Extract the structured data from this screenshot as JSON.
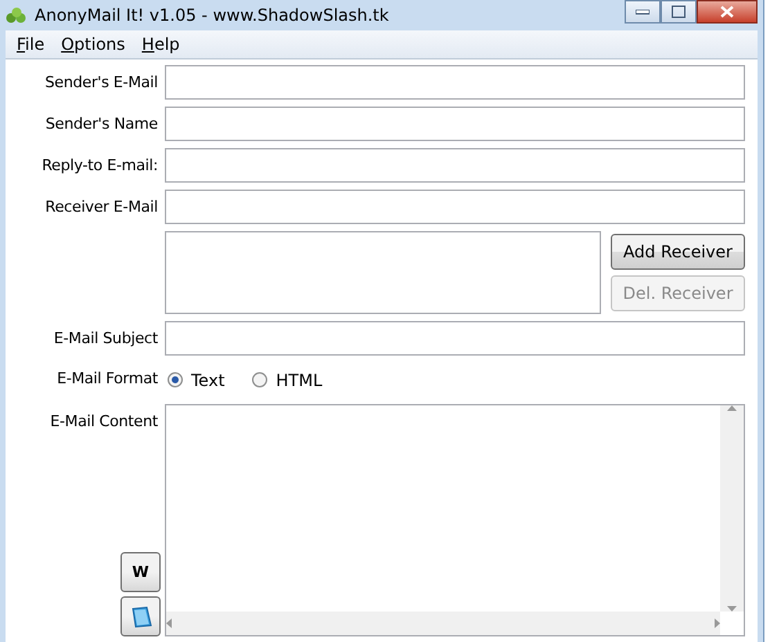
{
  "window": {
    "title": "AnonyMail It! v1.05 - www.ShadowSlash.tk"
  },
  "menu": [
    {
      "label": "File"
    },
    {
      "label": "Options"
    },
    {
      "label": "Help"
    }
  ],
  "fields": [
    {
      "label": "Sender's E-Mail"
    },
    {
      "label": "Sender's Name"
    },
    {
      "label": "Reply-to E-mail:"
    },
    {
      "label": "Receiver E-Mail"
    }
  ],
  "receiver_buttons": [
    {
      "label": "Add Receiver",
      "disabled": false
    },
    {
      "label": "Del. Receiver",
      "disabled": true
    }
  ],
  "subject": {
    "label": "E-Mail Subject"
  },
  "format": {
    "label": "E-Mail Format",
    "options": [
      {
        "label": "Text",
        "selected": true
      },
      {
        "label": "HTML",
        "selected": false
      }
    ]
  },
  "content": {
    "label": "E-Mail Content"
  },
  "side_buttons": [
    {
      "kind": "text",
      "label": "W"
    },
    {
      "kind": "icon"
    }
  ]
}
